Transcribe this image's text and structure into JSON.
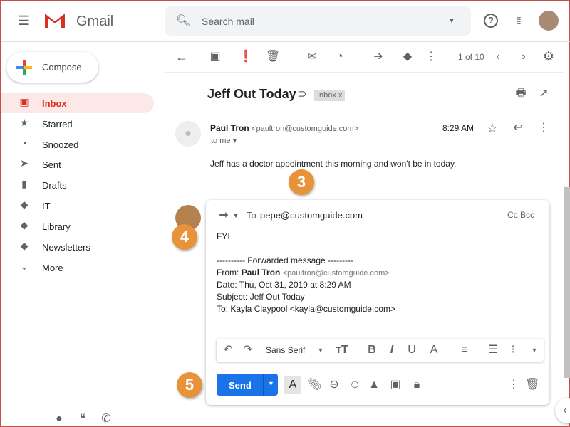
{
  "app": {
    "name": "Gmail",
    "brand_color": "#d93025",
    "accent": "#1a73e8"
  },
  "search": {
    "placeholder": "Search mail"
  },
  "compose_label": "Compose",
  "sidebar": {
    "items": [
      {
        "label": "Inbox",
        "icon": "inbox-icon",
        "active": true
      },
      {
        "label": "Starred",
        "icon": "star-icon"
      },
      {
        "label": "Snoozed",
        "icon": "clock-icon"
      },
      {
        "label": "Sent",
        "icon": "send-icon"
      },
      {
        "label": "Drafts",
        "icon": "file-icon"
      },
      {
        "label": "IT",
        "icon": "label-icon"
      },
      {
        "label": "Library",
        "icon": "label-icon"
      },
      {
        "label": "Newsletters",
        "icon": "label-icon"
      },
      {
        "label": "More",
        "icon": "chevron-down-icon"
      }
    ]
  },
  "toolbar": {
    "pagination": "1 of 10"
  },
  "email": {
    "subject": "Jeff Out Today",
    "label": "Inbox",
    "sender_name": "Paul Tron",
    "sender_email": "<paultron@customguide.com>",
    "time": "8:29  AM",
    "to": "to me",
    "body": "Jeff has a doctor appointment this morning and won't be in today."
  },
  "forward": {
    "to_label": "To",
    "to_value": "pepe@customguide.com",
    "cc_bcc": "Cc Bcc",
    "message": "FYI",
    "fwd_header": "---------- Forwarded message ---------",
    "from_label": "From:",
    "from_name": "Paul Tron",
    "from_email": "<paultron@customguide.com>",
    "date": "Date: Thu, Oct 31, 2019 at 8:29  AM",
    "subject": "Subject: Jeff Out Today",
    "to_line": "To: Kayla Claypool <kayla@customguide.com>"
  },
  "format": {
    "font": "Sans Serif"
  },
  "send_label": "Send",
  "callouts": [
    "3",
    "4",
    "5"
  ]
}
